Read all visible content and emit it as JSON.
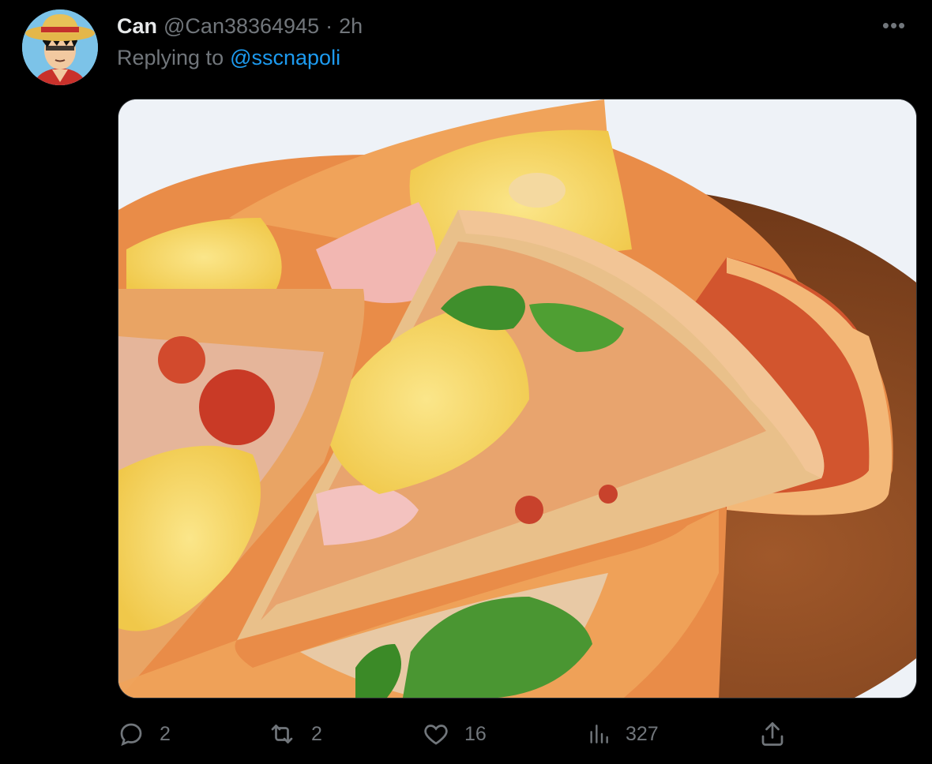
{
  "tweet": {
    "display_name": "Can",
    "handle": "@Can38364945",
    "separator": "·",
    "time": "2h",
    "replying_prefix": "Replying to",
    "replying_handle": "@sscnapoli",
    "more_glyph": "•••"
  },
  "actions": {
    "replies": "2",
    "retweets": "2",
    "likes": "16",
    "views": "327"
  },
  "icons": [
    "more-icon",
    "reply-icon",
    "retweet-icon",
    "like-icon",
    "views-icon",
    "share-icon"
  ],
  "colors": {
    "background": "#000000",
    "text_primary": "#e7e9ea",
    "text_secondary": "#71767b",
    "link": "#1d9bf0"
  }
}
